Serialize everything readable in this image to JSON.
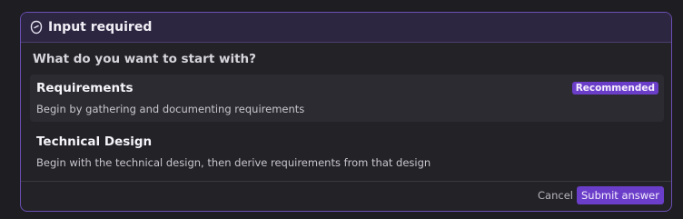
{
  "dialog": {
    "title": "Input required",
    "icon": "sparkle-icon",
    "question": "What do you want to start with?"
  },
  "options": [
    {
      "title": "Requirements",
      "description": "Begin by gathering and documenting requirements",
      "badge": "Recommended",
      "selected": true
    },
    {
      "title": "Technical Design",
      "description": "Begin with the technical design, then derive requirements from that design",
      "selected": false
    }
  ],
  "footer": {
    "cancel_label": "Cancel",
    "submit_label": "Submit answer"
  },
  "colors": {
    "accent": "#6b3ec9",
    "border": "#6a4fb3",
    "header_bg": "#2d2640"
  }
}
